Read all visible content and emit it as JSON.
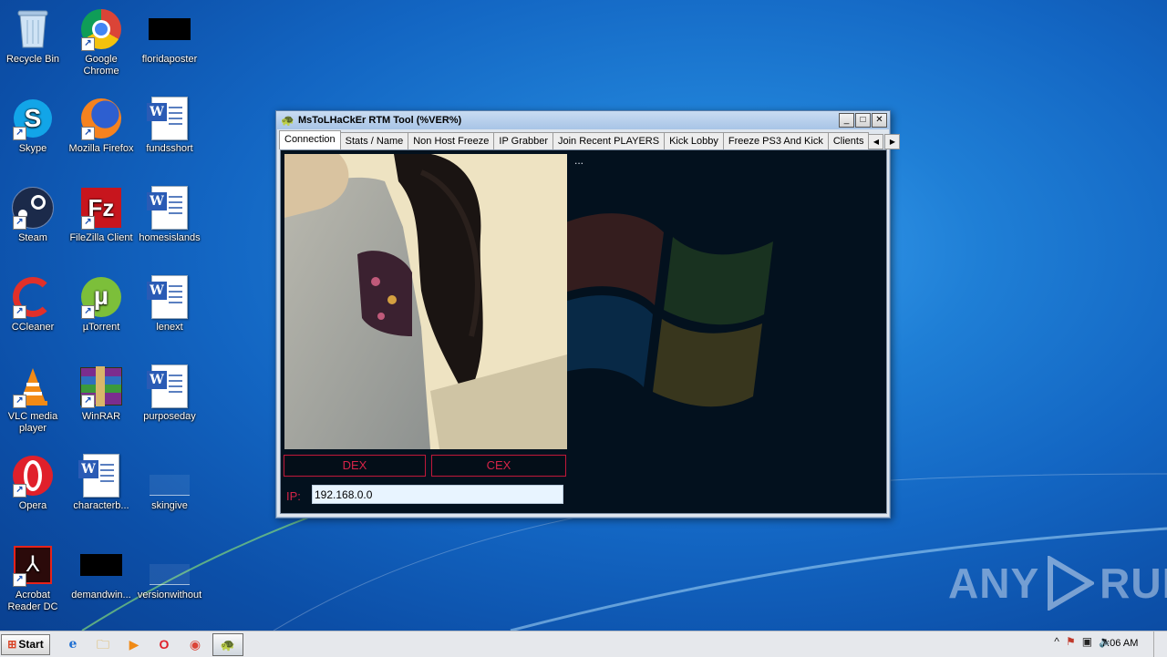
{
  "desktop": {
    "icons": [
      {
        "id": "recycle-bin",
        "label": "Recycle Bin",
        "icon": "recycle-bin-icon"
      },
      {
        "id": "google-chrome",
        "label": "Google Chrome",
        "icon": "chrome-icon"
      },
      {
        "id": "floridaposter",
        "label": "floridaposter",
        "icon": "black-thumbnail-icon"
      },
      {
        "id": "skype",
        "label": "Skype",
        "icon": "skype-icon"
      },
      {
        "id": "mozilla-firefox",
        "label": "Mozilla Firefox",
        "icon": "firefox-icon"
      },
      {
        "id": "fundsshort",
        "label": "fundsshort",
        "icon": "word-document-icon"
      },
      {
        "id": "steam",
        "label": "Steam",
        "icon": "steam-icon"
      },
      {
        "id": "filezilla",
        "label": "FileZilla Client",
        "icon": "filezilla-icon"
      },
      {
        "id": "homesislands",
        "label": "homesislands",
        "icon": "word-document-icon"
      },
      {
        "id": "ccleaner",
        "label": "CCleaner",
        "icon": "ccleaner-icon"
      },
      {
        "id": "utorrent",
        "label": "µTorrent",
        "icon": "utorrent-icon"
      },
      {
        "id": "lenext",
        "label": "lenext",
        "icon": "word-document-icon"
      },
      {
        "id": "vlc",
        "label": "VLC media player",
        "icon": "vlc-icon"
      },
      {
        "id": "winrar",
        "label": "WinRAR",
        "icon": "winrar-icon"
      },
      {
        "id": "purposeday",
        "label": "purposeday",
        "icon": "word-document-icon"
      },
      {
        "id": "opera",
        "label": "Opera",
        "icon": "opera-icon"
      },
      {
        "id": "characterb",
        "label": "characterb...",
        "icon": "word-document-icon"
      },
      {
        "id": "skingive",
        "label": "skingive",
        "icon": "blank-file-icon"
      },
      {
        "id": "acrobat",
        "label": "Acrobat Reader DC",
        "icon": "acrobat-icon"
      },
      {
        "id": "demandwin",
        "label": "demandwin...",
        "icon": "black-thumbnail-icon"
      },
      {
        "id": "versionwithout",
        "label": "versionwithout",
        "icon": "blank-file-icon"
      }
    ]
  },
  "window": {
    "title": "MsToLHaCkEr RTM Tool (%VER%)",
    "controls": {
      "minimize": "_",
      "maximize": "□",
      "close": "✕"
    },
    "tabs": [
      {
        "label": "Connection",
        "active": true
      },
      {
        "label": "Stats / Name",
        "active": false
      },
      {
        "label": "Non Host Freeze",
        "active": false
      },
      {
        "label": "IP Grabber",
        "active": false
      },
      {
        "label": "Join Recent PLAYERS",
        "active": false
      },
      {
        "label": "Kick Lobby",
        "active": false
      },
      {
        "label": "Freeze PS3 And Kick",
        "active": false
      },
      {
        "label": "Clients",
        "active": false
      }
    ],
    "tab_scroll": {
      "left": "◀",
      "right": "▶"
    },
    "connection": {
      "status_text": "...",
      "dex_label": "DEX",
      "cex_label": "CEX",
      "ip_label": "IP:",
      "ip_value": "192.168.0.0"
    }
  },
  "watermark": {
    "left": "ANY",
    "right": "RUN"
  },
  "taskbar": {
    "start_label": "Start",
    "pinned": [
      {
        "name": "ie-icon",
        "glyph": "e"
      },
      {
        "name": "explorer-icon",
        "glyph": "🗀"
      },
      {
        "name": "media-player-icon",
        "glyph": "▶"
      },
      {
        "name": "opera-icon",
        "glyph": "O"
      },
      {
        "name": "chrome-icon",
        "glyph": "◉"
      }
    ],
    "active_app_glyph": "🐢",
    "tray": {
      "chevron": "^",
      "clock": "7:06 AM"
    }
  },
  "colors": {
    "accent_red": "#d62448",
    "window_border": "#5b7ea8",
    "desktop_blue": "#1366c3"
  }
}
